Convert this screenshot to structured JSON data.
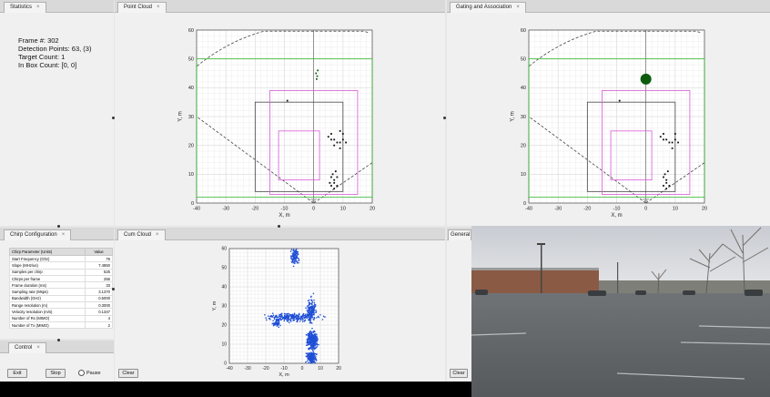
{
  "tabs": {
    "statistics": "Statistics",
    "point_cloud": "Point Cloud",
    "gating": "Gating and Association",
    "chirp": "Chirp Configuration",
    "control": "Control",
    "cumulative": "Cum Cloud",
    "general": "General",
    "close_glyph": "×"
  },
  "stats": {
    "frame": "Frame #: 302",
    "detection": "Detection Points: 63, (3)",
    "target": "Target Count: 1",
    "inbox": "In Box Count: [0, 0]"
  },
  "chirp_table": {
    "headers": [
      "Chirp Parameter (Units)",
      "Value"
    ],
    "rows": [
      [
        "Start Frequency (Ghz)",
        "76"
      ],
      [
        "Slope (MHz/us)",
        "7.4850"
      ],
      [
        "Samples per chirp",
        "525"
      ],
      [
        "Chirps per frame",
        "256"
      ],
      [
        "Frame duration (ms)",
        "33"
      ],
      [
        "Sampling rate (Msps)",
        "3.1370"
      ],
      [
        "Bandwidth (GHz)",
        "0.5000"
      ],
      [
        "Range resolution (m)",
        "0.3000"
      ],
      [
        "Velocity resolution (m/s)",
        "0.1347"
      ],
      [
        "Number of Rx (MIMO)",
        "4"
      ],
      [
        "Number of Tx (MIMO)",
        "2"
      ]
    ]
  },
  "controls": {
    "exit": "Exit",
    "stop": "Stop",
    "pause": "Pause",
    "clear": "Clear"
  },
  "chart_data": [
    {
      "type": "scatter",
      "xlabel": "X, m",
      "ylabel": "Y, m",
      "xlim": [
        -40,
        20
      ],
      "ylim": [
        0,
        60
      ],
      "xticks": [
        "-40",
        "-30",
        "-20",
        "-10",
        "0",
        "10",
        "20"
      ],
      "yticks": [
        "0",
        "10",
        "20",
        "30",
        "40",
        "50",
        "60"
      ],
      "points": [
        [
          1,
          43
        ],
        [
          1.2,
          44
        ],
        [
          0.8,
          45
        ],
        [
          1.4,
          46
        ],
        [
          5,
          23
        ],
        [
          6,
          22
        ],
        [
          7,
          22
        ],
        [
          8,
          21
        ],
        [
          9,
          21
        ],
        [
          10,
          22
        ],
        [
          11,
          21
        ],
        [
          7,
          20
        ],
        [
          9,
          19
        ],
        [
          10,
          24
        ],
        [
          9,
          25
        ],
        [
          6,
          24
        ],
        [
          6,
          9
        ],
        [
          7,
          8
        ],
        [
          7,
          7
        ],
        [
          6,
          6
        ],
        [
          8,
          6
        ],
        [
          7,
          5
        ],
        [
          6.5,
          10
        ],
        [
          7.5,
          11
        ],
        [
          5.5,
          7
        ],
        [
          8,
          9
        ],
        [
          -9,
          35.5
        ]
      ],
      "boxes": [
        {
          "x": [
            -40,
            20
          ],
          "y": [
            2,
            50
          ],
          "color": "#2fb52f"
        },
        {
          "x": [
            -20,
            10
          ],
          "y": [
            4,
            35
          ],
          "color": "#444444"
        },
        {
          "x": [
            -15,
            15
          ],
          "y": [
            3,
            39
          ],
          "color": "#d85ad8"
        },
        {
          "x": [
            -12,
            2
          ],
          "y": [
            8,
            25
          ],
          "color": "#d85ad8"
        }
      ]
    },
    {
      "type": "scatter",
      "xlabel": "X, m",
      "ylabel": "Y, m",
      "xlim": [
        -40,
        20
      ],
      "ylim": [
        0,
        60
      ],
      "xticks": [
        "-40",
        "-30",
        "-20",
        "-10",
        "0",
        "10",
        "20"
      ],
      "yticks": [
        "0",
        "10",
        "20",
        "30",
        "40",
        "50",
        "60"
      ],
      "points": [
        [
          5,
          23
        ],
        [
          6,
          22
        ],
        [
          7,
          22
        ],
        [
          8,
          21
        ],
        [
          9,
          21
        ],
        [
          10,
          22
        ],
        [
          11,
          21
        ],
        [
          9,
          19
        ],
        [
          10,
          24
        ],
        [
          6,
          24
        ],
        [
          6,
          9
        ],
        [
          7,
          8
        ],
        [
          7,
          7
        ],
        [
          6,
          6
        ],
        [
          8,
          6
        ],
        [
          7,
          5
        ],
        [
          6.5,
          10
        ],
        [
          7.5,
          11
        ],
        [
          -9,
          35.5
        ]
      ],
      "track": {
        "x": 0,
        "y": 43
      },
      "boxes": [
        {
          "x": [
            -40,
            20
          ],
          "y": [
            2,
            50
          ],
          "color": "#2fb52f"
        },
        {
          "x": [
            -20,
            10
          ],
          "y": [
            4,
            35
          ],
          "color": "#444444"
        },
        {
          "x": [
            -15,
            15
          ],
          "y": [
            3,
            39
          ],
          "color": "#d85ad8"
        },
        {
          "x": [
            -12,
            2
          ],
          "y": [
            8,
            25
          ],
          "color": "#d85ad8"
        }
      ]
    },
    {
      "type": "scatter",
      "xlabel": "X, m",
      "ylabel": "Y, m",
      "xlim": [
        -40,
        20
      ],
      "ylim": [
        0,
        60
      ],
      "xticks": [
        "-40",
        "-30",
        "-20",
        "-10",
        "0",
        "10",
        "20"
      ],
      "yticks": [
        "0",
        "10",
        "20",
        "30",
        "40",
        "50",
        "60"
      ],
      "clusters": [
        {
          "cx": -5,
          "cy": 24,
          "sx": 10,
          "sy": 1.5,
          "n": 260
        },
        {
          "cx": 5,
          "cy": 28,
          "sx": 1.8,
          "sy": 5,
          "n": 160
        },
        {
          "cx": 5.5,
          "cy": 12,
          "sx": 2.2,
          "sy": 4,
          "n": 320
        },
        {
          "cx": 5,
          "cy": 3,
          "sx": 2.2,
          "sy": 2.5,
          "n": 180
        },
        {
          "cx": -4,
          "cy": 56,
          "sx": 1.6,
          "sy": 3.5,
          "n": 120
        },
        {
          "cx": -14,
          "cy": 21,
          "sx": 2,
          "sy": 1.5,
          "n": 50
        }
      ]
    }
  ]
}
